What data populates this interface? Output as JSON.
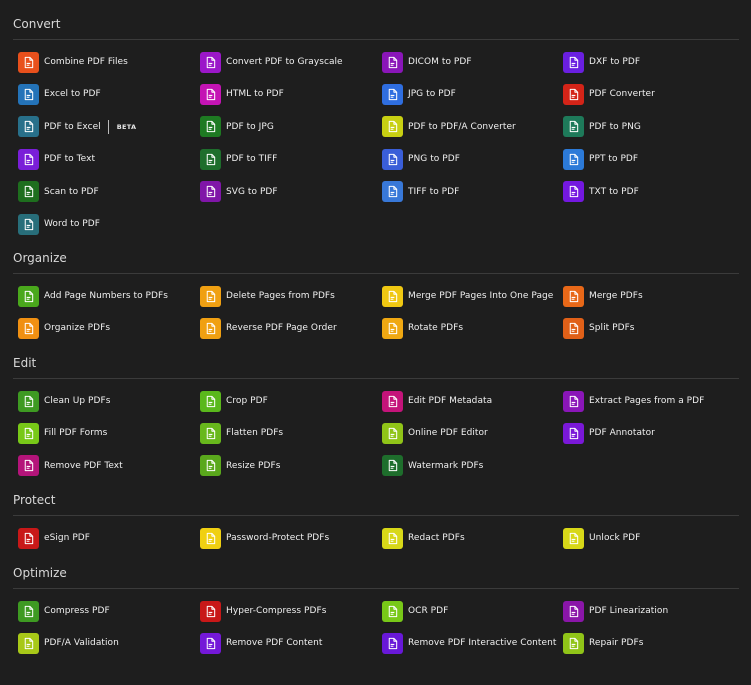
{
  "sections": [
    {
      "id": "convert",
      "title": "Convert",
      "tools": [
        {
          "label": "Combine PDF Files",
          "color": "#e8501c",
          "icon": "combine-icon"
        },
        {
          "label": "Convert PDF to Grayscale",
          "color": "#9b17c9",
          "icon": "grayscale-icon"
        },
        {
          "label": "DICOM to PDF",
          "color": "#8a16b8",
          "icon": "dicom-icon"
        },
        {
          "label": "DXF to PDF",
          "color": "#6a1fe0",
          "icon": "dxf-icon"
        },
        {
          "label": "Excel to PDF",
          "color": "#2473b8",
          "icon": "excel-icon"
        },
        {
          "label": "HTML to PDF",
          "color": "#c414b4",
          "icon": "html-icon"
        },
        {
          "label": "JPG to PDF",
          "color": "#2f6ee0",
          "icon": "jpg-icon"
        },
        {
          "label": "PDF Converter",
          "color": "#d42418",
          "icon": "converter-icon"
        },
        {
          "label": "PDF to Excel",
          "color": "#28708a",
          "icon": "pdf-excel-icon",
          "badge": "BETA"
        },
        {
          "label": "PDF to JPG",
          "color": "#1e7a22",
          "icon": "pdf-jpg-icon"
        },
        {
          "label": "PDF to PDF/A Converter",
          "color": "#c8d012",
          "icon": "pdfa-icon"
        },
        {
          "label": "PDF to PNG",
          "color": "#1e7a5a",
          "icon": "pdf-png-icon"
        },
        {
          "label": "PDF to Text",
          "color": "#7a1ed8",
          "icon": "pdf-text-icon"
        },
        {
          "label": "PDF to TIFF",
          "color": "#1e6e2c",
          "icon": "pdf-tiff-icon"
        },
        {
          "label": "PNG to PDF",
          "color": "#3a5ed8",
          "icon": "png-icon"
        },
        {
          "label": "PPT to PDF",
          "color": "#2c7ad8",
          "icon": "ppt-icon"
        },
        {
          "label": "Scan to PDF",
          "color": "#1e6e1e",
          "icon": "scan-icon"
        },
        {
          "label": "SVG to PDF",
          "color": "#8016a8",
          "icon": "svg-icon"
        },
        {
          "label": "TIFF to PDF",
          "color": "#3878d8",
          "icon": "tiff-icon"
        },
        {
          "label": "TXT to PDF",
          "color": "#7418e0",
          "icon": "txt-icon"
        },
        {
          "label": "Word to PDF",
          "color": "#286e7a",
          "icon": "word-icon"
        }
      ]
    },
    {
      "id": "organize",
      "title": "Organize",
      "tools": [
        {
          "label": "Add Page Numbers to PDFs",
          "color": "#4aa81c",
          "icon": "page-numbers-icon"
        },
        {
          "label": "Delete Pages from PDFs",
          "color": "#f0a012",
          "icon": "delete-pages-icon"
        },
        {
          "label": "Merge PDF Pages Into One Page",
          "color": "#f0c812",
          "icon": "merge-pages-icon"
        },
        {
          "label": "Merge PDFs",
          "color": "#e86818",
          "icon": "merge-icon"
        },
        {
          "label": "Organize PDFs",
          "color": "#f09012",
          "icon": "organize-icon"
        },
        {
          "label": "Reverse PDF Page Order",
          "color": "#f0a012",
          "icon": "reverse-icon"
        },
        {
          "label": "Rotate PDFs",
          "color": "#f0a812",
          "icon": "rotate-icon"
        },
        {
          "label": "Split PDFs",
          "color": "#e06018",
          "icon": "split-icon"
        }
      ]
    },
    {
      "id": "edit",
      "title": "Edit",
      "tools": [
        {
          "label": "Clean Up PDFs",
          "color": "#3e9a22",
          "icon": "cleanup-icon"
        },
        {
          "label": "Crop PDF",
          "color": "#5ab81c",
          "icon": "crop-icon"
        },
        {
          "label": "Edit PDF Metadata",
          "color": "#c4147a",
          "icon": "metadata-icon"
        },
        {
          "label": "Extract Pages from a PDF",
          "color": "#8a16b8",
          "icon": "extract-icon"
        },
        {
          "label": "Fill PDF Forms",
          "color": "#78c818",
          "icon": "fill-forms-icon"
        },
        {
          "label": "Flatten PDFs",
          "color": "#68b81c",
          "icon": "flatten-icon"
        },
        {
          "label": "Online PDF Editor",
          "color": "#90c418",
          "icon": "editor-icon"
        },
        {
          "label": "PDF Annotator",
          "color": "#7a18d8",
          "icon": "annotator-icon"
        },
        {
          "label": "Remove PDF Text",
          "color": "#b4147a",
          "icon": "remove-text-icon"
        },
        {
          "label": "Resize PDFs",
          "color": "#5aa81c",
          "icon": "resize-icon"
        },
        {
          "label": "Watermark PDFs",
          "color": "#1e6e2c",
          "icon": "watermark-icon"
        }
      ]
    },
    {
      "id": "protect",
      "title": "Protect",
      "tools": [
        {
          "label": "eSign PDF",
          "color": "#c81818",
          "icon": "esign-icon"
        },
        {
          "label": "Password-Protect PDFs",
          "color": "#f0d012",
          "icon": "password-icon"
        },
        {
          "label": "Redact PDFs",
          "color": "#d8d818",
          "icon": "redact-icon"
        },
        {
          "label": "Unlock PDF",
          "color": "#d8d818",
          "icon": "unlock-icon"
        }
      ]
    },
    {
      "id": "optimize",
      "title": "Optimize",
      "tools": [
        {
          "label": "Compress PDF",
          "color": "#3e9a22",
          "icon": "compress-icon"
        },
        {
          "label": "Hyper-Compress PDFs",
          "color": "#c81818",
          "icon": "hyper-compress-icon"
        },
        {
          "label": "OCR PDF",
          "color": "#78c818",
          "icon": "ocr-icon"
        },
        {
          "label": "PDF Linearization",
          "color": "#8a16a8",
          "icon": "linearize-icon"
        },
        {
          "label": "PDF/A Validation",
          "color": "#a8c818",
          "icon": "pdfa-validate-icon"
        },
        {
          "label": "Remove PDF Content",
          "color": "#7418d8",
          "icon": "remove-content-icon"
        },
        {
          "label": "Remove PDF Interactive Content",
          "color": "#6818d8",
          "icon": "remove-interactive-icon"
        },
        {
          "label": "Repair PDFs",
          "color": "#90c418",
          "icon": "repair-icon"
        }
      ]
    }
  ]
}
